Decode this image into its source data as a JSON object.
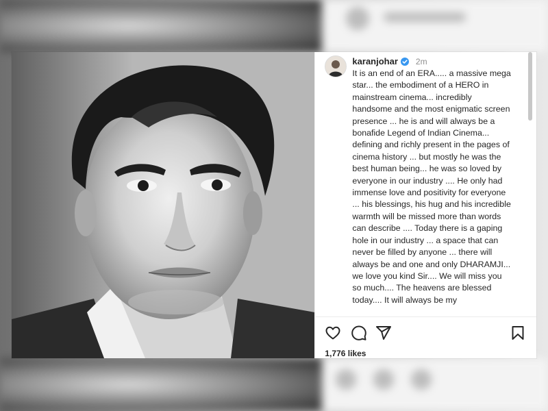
{
  "post": {
    "username": "karanjohar",
    "verified": true,
    "time_ago": "2m",
    "caption": "It is an end of an ERA..... a massive mega star... the embodiment of a HERO in mainstream cinema... incredibly handsome and the most  enigmatic screen presence ... he is and will always be a bonafide Legend of Indian Cinema... defining and richly present in the pages of cinema history ... but mostly he was the best human being... he was so loved by everyone in our industry .... He only had immense love and positivity for everyone ... his blessings, his hug and his incredible warmth will be missed more than words can describe .... Today there is a gaping hole in our industry ... a space that can never be filled by anyone ... there will always be and one and only DHARAMJI... we love you kind Sir.... We will miss you so much.... The heavens are blessed today.... It will always be my",
    "likes": "1,776 likes"
  },
  "icons": {
    "like": "heart-icon",
    "comment": "comment-icon",
    "share": "share-icon",
    "save": "bookmark-icon",
    "verified": "verified-badge-icon"
  },
  "colors": {
    "verified_blue": "#3897f0",
    "text": "#262626",
    "muted": "#8e8e8e"
  }
}
